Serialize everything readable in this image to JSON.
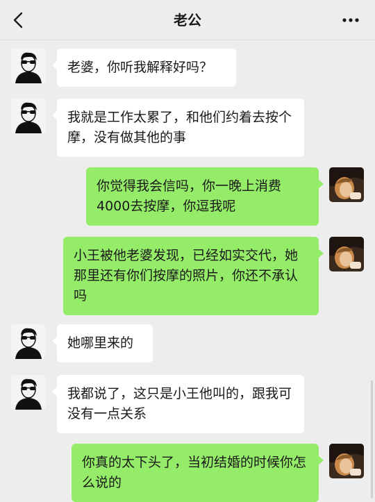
{
  "header": {
    "title": "老公",
    "back_icon": "chevron-left-icon",
    "more_icon": "more-dots-icon"
  },
  "colors": {
    "background": "#ededed",
    "incoming_bubble": "#ffffff",
    "outgoing_bubble": "#95ec69"
  },
  "messages": [
    {
      "side": "in",
      "text": "老婆，你听我解释好吗？"
    },
    {
      "side": "in",
      "text": "我就是工作太累了，和他们约着去按个摩，没有做其他的事"
    },
    {
      "side": "out",
      "text": "你觉得我会信吗，你一晚上消费4000去按摩，你逗我呢"
    },
    {
      "side": "out",
      "text": "小王被他老婆发现，已经如实交代，她那里还有你们按摩的照片，你还不承认吗"
    },
    {
      "side": "in",
      "text": "她哪里来的"
    },
    {
      "side": "in",
      "text": "我都说了，这只是小王他叫的，跟我可没有一点关系"
    },
    {
      "side": "out",
      "text": "你真的太下头了，当初结婚的时候你怎么说的"
    }
  ]
}
